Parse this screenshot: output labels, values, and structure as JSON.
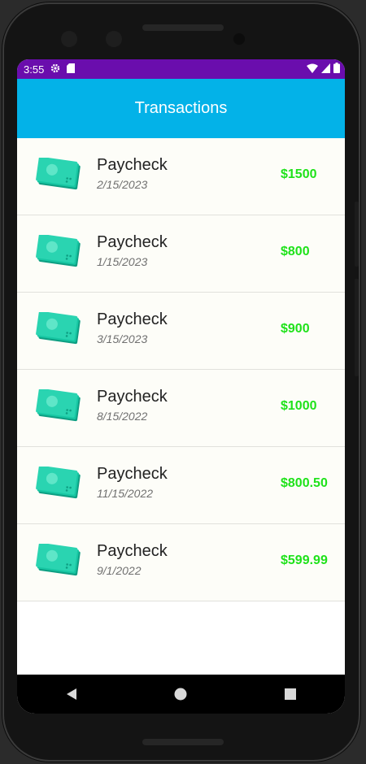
{
  "status_bar": {
    "time": "3:55",
    "icons": [
      "settings-icon",
      "sd-card-icon",
      "wifi-icon",
      "signal-icon",
      "battery-icon"
    ]
  },
  "app_bar": {
    "title": "Transactions"
  },
  "transactions": [
    {
      "name": "Paycheck",
      "date": "2/15/2023",
      "amount": "$1500"
    },
    {
      "name": "Paycheck",
      "date": "1/15/2023",
      "amount": "$800"
    },
    {
      "name": "Paycheck",
      "date": "3/15/2023",
      "amount": "$900"
    },
    {
      "name": "Paycheck",
      "date": "8/15/2022",
      "amount": "$1000"
    },
    {
      "name": "Paycheck",
      "date": "11/15/2022",
      "amount": "$800.50"
    },
    {
      "name": "Paycheck",
      "date": "9/1/2022",
      "amount": "$599.99"
    }
  ],
  "nav_bar": {
    "icons": [
      "back-icon",
      "home-icon",
      "recents-icon"
    ]
  },
  "colors": {
    "status_bar": "#6a0dad",
    "app_bar": "#03b2e8",
    "amount": "#1fe21a",
    "money_icon": "#17c7a3"
  }
}
